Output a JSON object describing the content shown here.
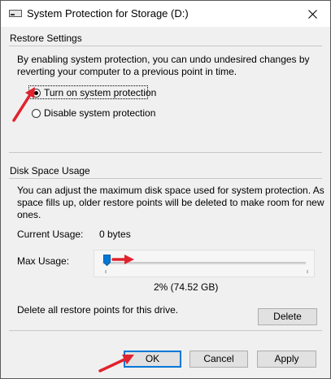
{
  "window": {
    "title": "System Protection for Storage (D:)",
    "close_glyph": "✕"
  },
  "restore_settings": {
    "title": "Restore Settings",
    "description_line1": "By enabling system protection, you can undo undesired changes by",
    "description_line2": "reverting your computer to a previous point in time.",
    "options": [
      {
        "label": "Turn on system protection",
        "checked": true
      },
      {
        "label": "Disable system protection",
        "checked": false
      }
    ]
  },
  "disk_space": {
    "title": "Disk Space Usage",
    "description_line1": "You can adjust the maximum disk space used for system protection. As",
    "description_line2": "space fills up, older restore points will be deleted to make room for new",
    "description_line3": "ones.",
    "current_usage_label": "Current Usage:",
    "current_usage_value": "0 bytes",
    "max_usage_label": "Max Usage:",
    "max_usage_percent": 2,
    "max_usage_readout": "2% (74.52 GB)",
    "delete_text": "Delete all restore points for this drive.",
    "delete_button": "Delete"
  },
  "footer": {
    "ok": "OK",
    "cancel": "Cancel",
    "apply": "Apply"
  },
  "colors": {
    "annotation_arrow": "#e0232e",
    "slider_thumb": "#0078d7",
    "default_button_border": "#0078d7"
  },
  "icons": {
    "app": "drive-icon",
    "close": "close-icon"
  }
}
